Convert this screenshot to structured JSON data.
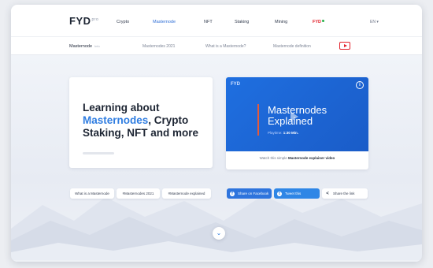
{
  "brand": {
    "logo": "FYD",
    "logo_sup": "pro"
  },
  "nav": {
    "items": [
      "Crypto",
      "Masternode",
      "NFT",
      "Staking",
      "Mining",
      "FYD"
    ],
    "lang": "EN"
  },
  "subnav": {
    "title": "Masternode",
    "title_sub": "Info",
    "links": [
      "Masternodes 2021",
      "What is a Masternode?",
      "Masternode definition"
    ]
  },
  "hero": {
    "line1": "Learning about",
    "highlight": "Masternodes",
    "line2": ", Crypto",
    "line3": "Staking, NFT and more"
  },
  "video": {
    "logo": "FYD",
    "title": "Masternodes Explained",
    "meta_label": "Playtime:",
    "meta_value": "1:30 Min.",
    "caption_pre": "Watch this simple",
    "caption_bold": "Masternode explainer video"
  },
  "pills": [
    "What is a Masternode",
    "#Masternodes 2021",
    "#Masternode explained"
  ],
  "share": {
    "facebook": "Share on Facebook",
    "twitter": "Tweet this",
    "link": "Share the link"
  },
  "colors": {
    "accent": "#2f7de1",
    "brand_red": "#e2202a",
    "facebook": "#2e74dd",
    "twitter": "#2f86e6"
  }
}
